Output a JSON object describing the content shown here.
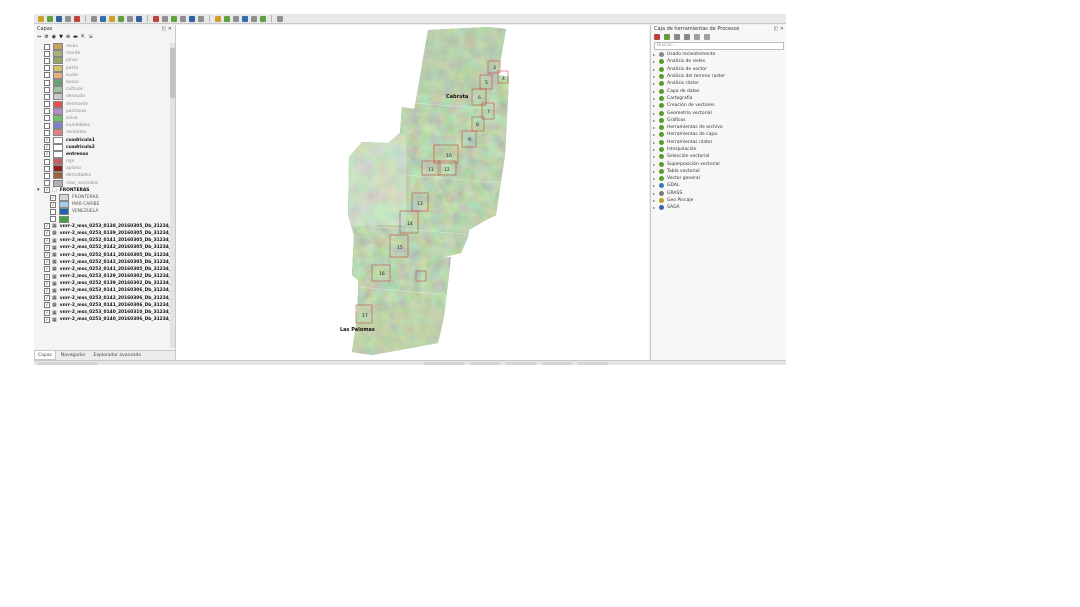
{
  "layers_panel": {
    "title": "Capas",
    "controls": "◰ ✕",
    "tools": [
      "⇔",
      "⚙",
      "◉",
      "▼",
      "⊕",
      "▬",
      "⇱",
      "⇲"
    ],
    "items": [
      {
        "label": "rocas",
        "color": "#c8a060",
        "checked": false,
        "style": "faded"
      },
      {
        "label": "monte",
        "color": "#a8b080",
        "checked": false,
        "style": "faded"
      },
      {
        "label": "pinos",
        "color": "#8fa86a",
        "checked": false,
        "style": "faded"
      },
      {
        "label": "pasto",
        "color": "#d0c070",
        "checked": false,
        "style": "faded"
      },
      {
        "label": "suelo",
        "color": "#e0b080",
        "checked": false,
        "style": "faded"
      },
      {
        "label": "bosco",
        "color": "#6aa070",
        "checked": false,
        "style": "faded"
      },
      {
        "label": "cultivos",
        "color": "#a0c0a0",
        "checked": false,
        "style": "faded"
      },
      {
        "label": "desnudo",
        "color": "#c8c8c8",
        "checked": false,
        "style": "faded"
      },
      {
        "label": "desmonte",
        "color": "#e05050",
        "checked": false,
        "style": "faded"
      },
      {
        "label": "pantanos",
        "color": "#b090c0",
        "checked": false,
        "style": "faded"
      },
      {
        "label": "selva",
        "color": "#70c070",
        "checked": false,
        "style": "faded"
      },
      {
        "label": "inundables",
        "color": "#8080c8",
        "checked": false,
        "style": "faded"
      },
      {
        "label": "recientes",
        "color": "#e08080",
        "checked": false,
        "style": "faded"
      },
      {
        "label": "cuadricula1",
        "color": "#ffffff",
        "checked": true,
        "style": "bold"
      },
      {
        "label": "cuadricula2",
        "color": "#ffffff",
        "checked": true,
        "style": "bold"
      },
      {
        "label": "entrenos",
        "color": "#ffffff",
        "checked": true,
        "style": "bold"
      },
      {
        "label": "rojo",
        "color": "#c06060",
        "checked": false,
        "style": "faded"
      },
      {
        "label": "aplano",
        "color": "#8b2020",
        "checked": false,
        "style": "faded"
      },
      {
        "label": "densidades",
        "color": "#a06040",
        "checked": false,
        "style": "faded"
      },
      {
        "label": "reas_vecinales",
        "color": "#b0b0b0",
        "checked": false,
        "style": "faded"
      }
    ],
    "group": {
      "label": "FRONTERAS",
      "expanded": "▾"
    },
    "group_items": [
      {
        "label": "FRONTERAS",
        "color": "#d8d8d8",
        "checked": true
      },
      {
        "label": "MAR CARIBE",
        "color": "#a8c8e8",
        "checked": true
      },
      {
        "label": "VENEZUELA",
        "color": "#2060b0",
        "checked": false
      },
      {
        "label": "",
        "color": "#40a040",
        "checked": false
      }
    ],
    "raster_items": [
      "vnrr-2_mss_0253_0138_20160305_Db_31234_",
      "vnrr-2_mss_0253_0139_20160305_Db_31234_",
      "vnrr-2_mss_0252_0141_20160305_Db_31234_",
      "vnrr-2_mss_0252_0142_20160305_Db_31234_",
      "vnrr-2_mss_0252_0141_20160305_Db_31234_",
      "vnrr-2_mss_0252_0142_20160305_Db_31234_",
      "vnrr-2_mss_0253_0141_20160305_Db_31234_",
      "vnrr-2_mss_0253_0139_20160302_Db_31234_",
      "vnrr-2_mss_0252_0139_20160302_Db_31234_",
      "vnrr-2_mss_0253_0141_20160306_Db_31234_",
      "vnrr-2_mss_0253_0142_20160306_Db_31234_",
      "vnrr-2_mss_0253_0141_20160306_Db_31234_",
      "vnrr-2_mss_0253_0140_20160310_Db_31234_",
      "vnrr-2_mss_0253_0140_20160306_Db_31234_"
    ],
    "tabs": [
      "Capas",
      "Navegador",
      "Explorador avanzado"
    ]
  },
  "map": {
    "place_labels": [
      "Cabruta",
      "Las Palomas"
    ],
    "grid_numbers": [
      "3",
      "4",
      "5",
      "6",
      "7",
      "8",
      "9",
      "10",
      "11",
      "12",
      "13",
      "14",
      "15",
      "16",
      "17"
    ]
  },
  "toolbox": {
    "title": "Caja de herramientas de Procesos",
    "controls": "◰ ✕",
    "search_placeholder": "Buscar...",
    "items": [
      {
        "label": "Usado recientemente",
        "icon": "clock-icon",
        "color": "#888888"
      },
      {
        "label": "Análisis de redes",
        "icon": "qgis-icon",
        "color": "#5a9a2a"
      },
      {
        "label": "Análisis de vector",
        "icon": "qgis-icon",
        "color": "#5a9a2a"
      },
      {
        "label": "Análisis del terreno raster",
        "icon": "qgis-icon",
        "color": "#5a9a2a"
      },
      {
        "label": "Análisis ráster",
        "icon": "qgis-icon",
        "color": "#5a9a2a"
      },
      {
        "label": "Capa de datos",
        "icon": "qgis-icon",
        "color": "#5a9a2a"
      },
      {
        "label": "Cartografía",
        "icon": "qgis-icon",
        "color": "#5a9a2a"
      },
      {
        "label": "Creación de vectores",
        "icon": "qgis-icon",
        "color": "#5a9a2a"
      },
      {
        "label": "Geometría vectorial",
        "icon": "qgis-icon",
        "color": "#5a9a2a"
      },
      {
        "label": "Gráficos",
        "icon": "qgis-icon",
        "color": "#5a9a2a"
      },
      {
        "label": "Herramientas de archivo",
        "icon": "qgis-icon",
        "color": "#5a9a2a"
      },
      {
        "label": "Herramientas de capa",
        "icon": "qgis-icon",
        "color": "#5a9a2a"
      },
      {
        "label": "Herramientas ráster",
        "icon": "qgis-icon",
        "color": "#5a9a2a"
      },
      {
        "label": "Interpolación",
        "icon": "qgis-icon",
        "color": "#5a9a2a"
      },
      {
        "label": "Selección vectorial",
        "icon": "qgis-icon",
        "color": "#5a9a2a"
      },
      {
        "label": "Superposición vectorial",
        "icon": "qgis-icon",
        "color": "#5a9a2a"
      },
      {
        "label": "Tabla vectorial",
        "icon": "qgis-icon",
        "color": "#5a9a2a"
      },
      {
        "label": "Vector general",
        "icon": "qgis-icon",
        "color": "#5a9a2a"
      },
      {
        "label": "GDAL",
        "icon": "gdal-icon",
        "color": "#3a7ab0"
      },
      {
        "label": "GRASS",
        "icon": "grass-icon",
        "color": "#7a7a7a"
      },
      {
        "label": "Geo Pincaje",
        "icon": "pin-icon",
        "color": "#c0a020"
      },
      {
        "label": "SAGA",
        "icon": "saga-icon",
        "color": "#4060b0"
      }
    ]
  },
  "colors": {
    "map_green": "#6f8a5e",
    "grid_red": "#c03030",
    "panel_bg": "#f4f4f4"
  }
}
